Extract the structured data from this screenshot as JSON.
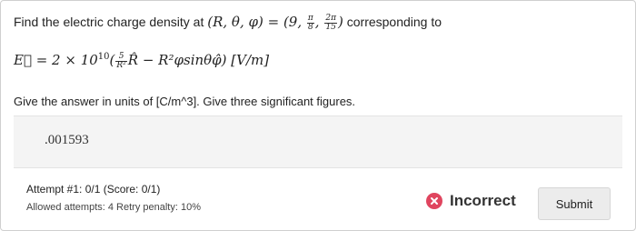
{
  "question": {
    "lead": "Find the electric charge density at ",
    "point_vars": "(R, θ, φ) = (9, ",
    "frac1_num": "π",
    "frac1_den": "8",
    "sep": ", ",
    "frac2_num": "2π",
    "frac2_den": "15",
    "point_close": ")",
    "tail": " corresponding to"
  },
  "equation": {
    "lhs": "E⃗ = 2 × 10",
    "exponent": "10",
    "open": "(",
    "frac_num": "5",
    "frac_den": "R²",
    "rest": "R̂ − R²φsinθφ̂) [V/m]"
  },
  "instructions": "Give the answer in units of [C/m^3]. Give three significant figures.",
  "answer": {
    "value": ".001593"
  },
  "attempt": {
    "text": "Attempt #1: 0/1   (Score: 0/1)"
  },
  "limits": {
    "text": "Allowed attempts: 4   Retry penalty: 10%"
  },
  "result": {
    "label": "Incorrect",
    "icon": "x-circle-icon",
    "icon_color": "#e0455f"
  },
  "submit_label": "Submit"
}
